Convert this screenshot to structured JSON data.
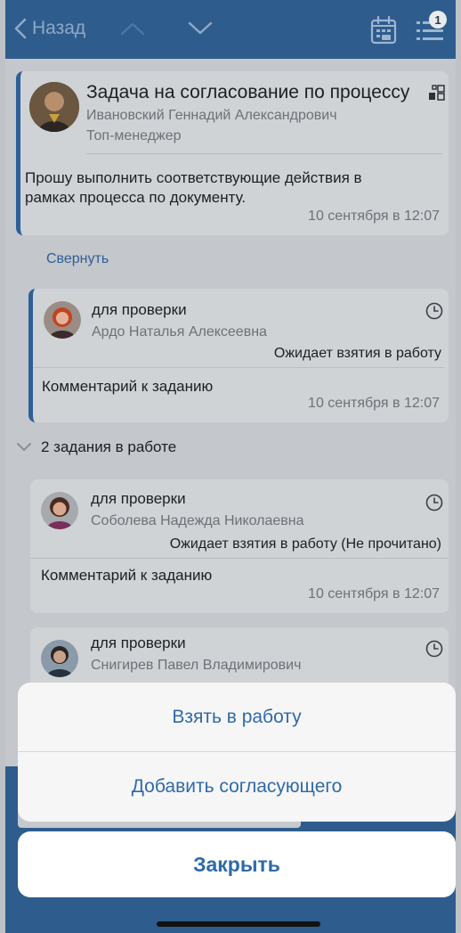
{
  "navbar": {
    "back_label": "Назад",
    "badge_count": "1"
  },
  "main_task": {
    "title": "Задача на согласование по процессу",
    "author": "Ивановский Геннадий Александрович",
    "role": "Топ-менеджер",
    "message_line1": "Прошу выполнить соответствующие действия в",
    "message_line2": "рамках процесса по документу.",
    "date": "10 сентября в 12:07"
  },
  "collapse_label": "Свернуть",
  "tasks": [
    {
      "title": "для проверки",
      "assignee": "Ардо Наталья Алексеевна",
      "status": "Ожидает взятия в работу",
      "comment": "Комментарий к заданию",
      "date": "10 сентября в 12:07"
    },
    {
      "title": "для проверки",
      "assignee": "Соболева Надежда Николаевна",
      "status": "Ожидает взятия в работу (Не прочитано)",
      "comment": "Комментарий к заданию",
      "date": "10 сентября в 12:07"
    },
    {
      "title": "для проверки",
      "assignee": "Снигирев Павел Владимирович"
    }
  ],
  "group_header": "2 задания в работе",
  "action_sheet": {
    "take_to_work": "Взять в работу",
    "add_approver": "Добавить согласующего",
    "close": "Закрыть"
  },
  "colors": {
    "accent": "#2f5f98",
    "link": "#2f6aa8",
    "navbar": "#2e5c8d"
  }
}
